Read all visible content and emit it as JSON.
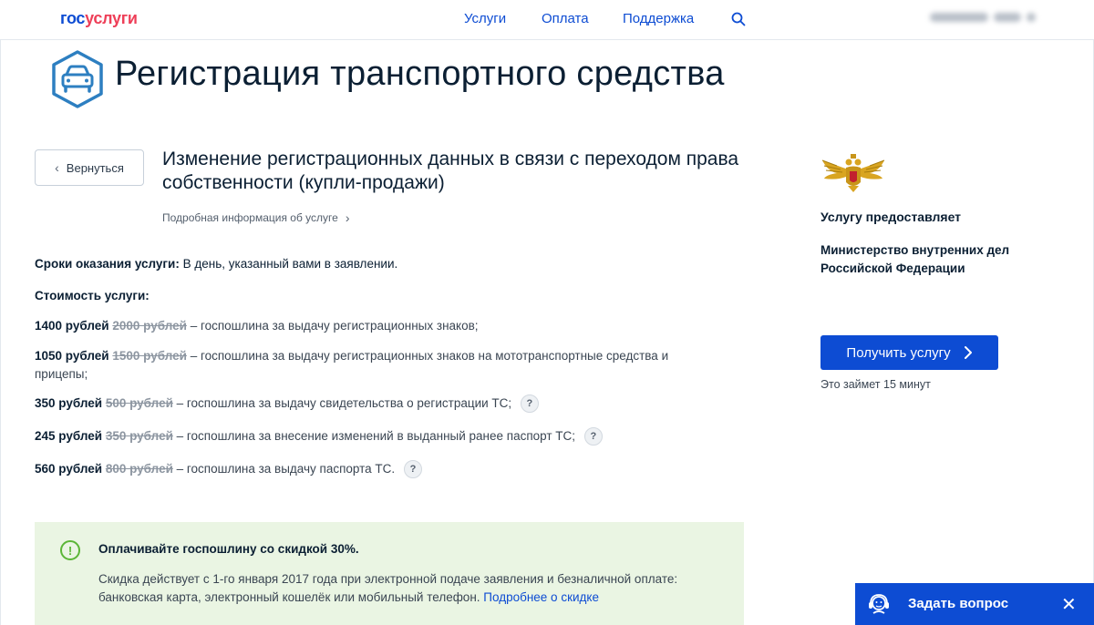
{
  "header": {
    "logo_part1": "гос",
    "logo_part2": "услуги",
    "nav": [
      "Услуги",
      "Оплата",
      "Поддержка"
    ]
  },
  "page": {
    "title": "Регистрация транспортного средства",
    "back_label": "Вернуться",
    "service_title": "Изменение регистрационных данных в связи с переходом права собственности (купли-продажи)",
    "more_info": "Подробная информация об услуге"
  },
  "terms": {
    "label": "Сроки оказания услуги:",
    "value": "В день, указанный вами в заявлении."
  },
  "cost_label": "Стоимость услуги:",
  "fees": [
    {
      "price": "1400 рублей",
      "old": "2000 рублей",
      "desc": "– госпошлина за выдачу регистрационных знаков;",
      "help": ""
    },
    {
      "price": "1050 рублей",
      "old": "1500 рублей",
      "desc": "– госпошлина за выдачу регистрационных знаков на мототранспортные средства и",
      "desc2": "прицепы;",
      "help": ""
    },
    {
      "price": "350 рублей",
      "old": "500 рублей",
      "desc": "– госпошлина за выдачу свидетельства о регистрации ТС;",
      "help": "?"
    },
    {
      "price": "245 рублей",
      "old": "350 рублей",
      "desc": "– госпошлина за внесение изменений в выданный ранее паспорт ТС;",
      "help": "?"
    },
    {
      "price": "560 рублей",
      "old": "800 рублей",
      "desc": "– госпошлина за выдачу паспорта ТС.",
      "help": "?"
    }
  ],
  "discount": {
    "icon": "!",
    "title": "Оплачивайте госпошлину со скидкой 30%.",
    "text": "Скидка действует с 1-го января 2017 года при электронной подаче заявления и безналичной оплате: банковская карта, электронный кошелёк или мобильный телефон.",
    "link": "Подробнее о скидке"
  },
  "provider": {
    "label": "Услугу предоставляет",
    "name": "Министерство внутренних дел Российской Федерации"
  },
  "action": {
    "button": "Получить услугу",
    "note": "Это займет 15 минут"
  },
  "ask": {
    "label": "Задать вопрос",
    "close": "✕"
  },
  "colors": {
    "brand_blue": "#0d4cd3",
    "brand_red": "#ee3f58",
    "discount_bg": "#eaf5e3",
    "discount_accent": "#5bb637"
  },
  "icons": [
    "search-icon",
    "car-icon",
    "chevron-left-icon",
    "chevron-right-icon",
    "exclamation-icon",
    "help-icon",
    "emblem-icon",
    "support-agent-icon",
    "close-icon"
  ]
}
